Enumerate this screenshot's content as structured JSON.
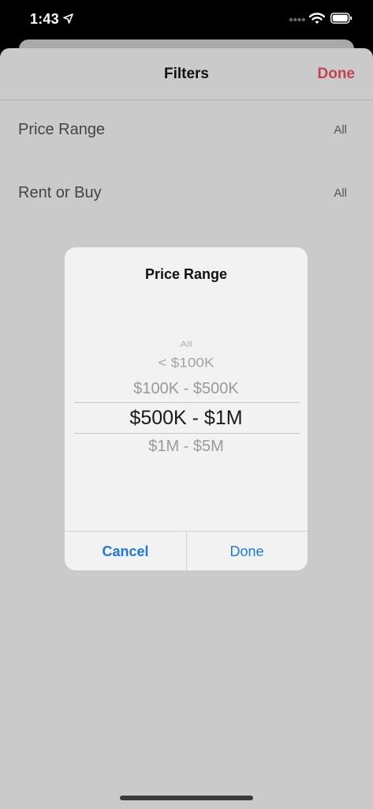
{
  "status": {
    "time": "1:43"
  },
  "nav": {
    "title": "Filters",
    "done_label": "Done"
  },
  "rows": [
    {
      "label": "Price Range",
      "value": "All"
    },
    {
      "label": "Rent or Buy",
      "value": "All"
    }
  ],
  "dialog": {
    "title": "Price Range",
    "options": [
      "All",
      "< $100K",
      "$100K - $500K",
      "$500K - $1M",
      "$1M - $5M"
    ],
    "selected": "$500K - $1M",
    "cancel_label": "Cancel",
    "done_label": "Done"
  },
  "colors": {
    "accent_done": "#c2454e",
    "dialog_button": "#1e7ad6",
    "overlay_background": "#cacaca"
  }
}
